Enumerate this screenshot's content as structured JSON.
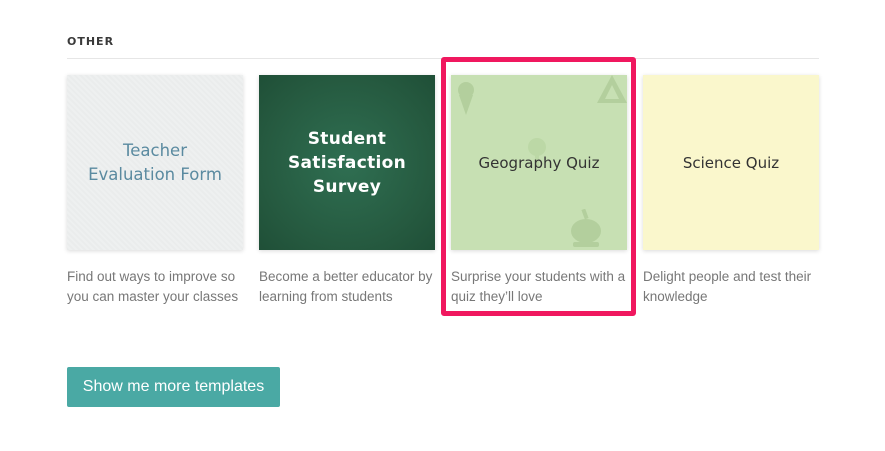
{
  "section": {
    "title": "OTHER"
  },
  "templates": [
    {
      "title": "Teacher Evaluation Form",
      "description": "Find out ways to improve so you can master your classes"
    },
    {
      "title": "Student Satisfaction Survey",
      "description": "Become a better educator by learning from students"
    },
    {
      "title": "Geography Quiz",
      "description": "Surprise your students with a quiz they’ll love"
    },
    {
      "title": "Science Quiz",
      "description": "Delight people and test their knowledge"
    }
  ],
  "colors": {
    "accent_button": "#4aa9a4",
    "highlight_border": "#f0185f",
    "geography_bg": "#c7e0b3",
    "science_bg": "#faf7cc",
    "chalkboard_bg": "#25593f",
    "teacher_bg": "#eef0f0"
  },
  "buttons": {
    "more_templates": "Show me more templates"
  }
}
